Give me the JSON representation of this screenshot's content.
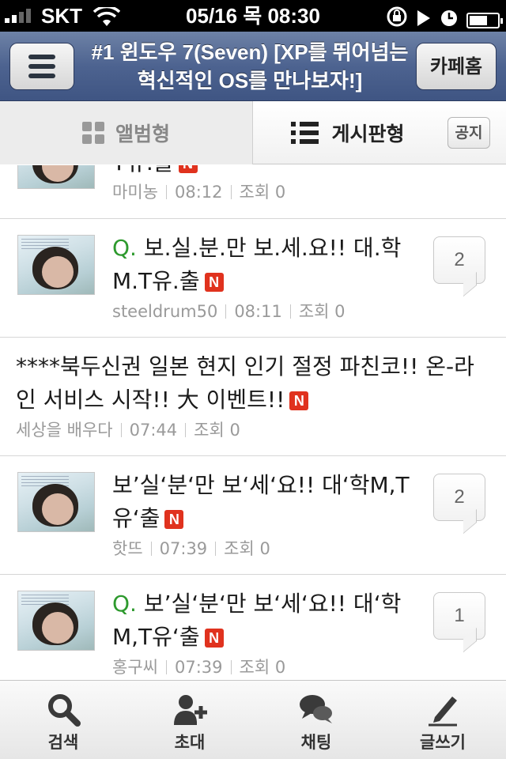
{
  "status_bar": {
    "carrier": "SKT",
    "time": "05/16 목 08:30"
  },
  "nav": {
    "title": "#1 윈도우 7(Seven) [XP를 뛰어넘는 혁신적인 OS를 만나보자!]",
    "cafe_home_label": "카페홈"
  },
  "view_tabs": {
    "album_label": "앨범형",
    "board_label": "게시판형",
    "notice_label": "공지"
  },
  "posts": [
    {
      "prefix": "",
      "title": "T유.출",
      "new": "N",
      "author": "마미농",
      "time": "08:12",
      "views": "조회 0",
      "comments": ""
    },
    {
      "prefix": "Q.",
      "title": "보.실.분.만 보.세.요!! 대.학M.T유.출",
      "new": "N",
      "author": "steeldrum50",
      "time": "08:11",
      "views": "조회 0",
      "comments": "2"
    },
    {
      "prefix": "",
      "title": "****북두신권 일본 현지 인기 절정 파친코!! 온-라인 서비스 시작!! 大 이벤트!!",
      "new": "N",
      "author": "세상을 배우다",
      "time": "07:44",
      "views": "조회 0",
      "comments": ""
    },
    {
      "prefix": "",
      "title": "보’실‘분‘만 보‘세‘요!! 대‘학M,T유‘출",
      "new": "N",
      "author": "핫뜨",
      "time": "07:39",
      "views": "조회 0",
      "comments": "2"
    },
    {
      "prefix": "Q.",
      "title": "보’실‘분‘만 보‘세‘요!! 대‘학M,T유‘출",
      "new": "N",
      "author": "홍구씨",
      "time": "07:39",
      "views": "조회 0",
      "comments": "1"
    }
  ],
  "tabbar": {
    "search_label": "검색",
    "invite_label": "초대",
    "chat_label": "채팅",
    "write_label": "글쓰기"
  },
  "colors": {
    "nav_blue": "#4d6390",
    "new_badge": "#e0321e",
    "question_green": "#2e9a2e"
  }
}
